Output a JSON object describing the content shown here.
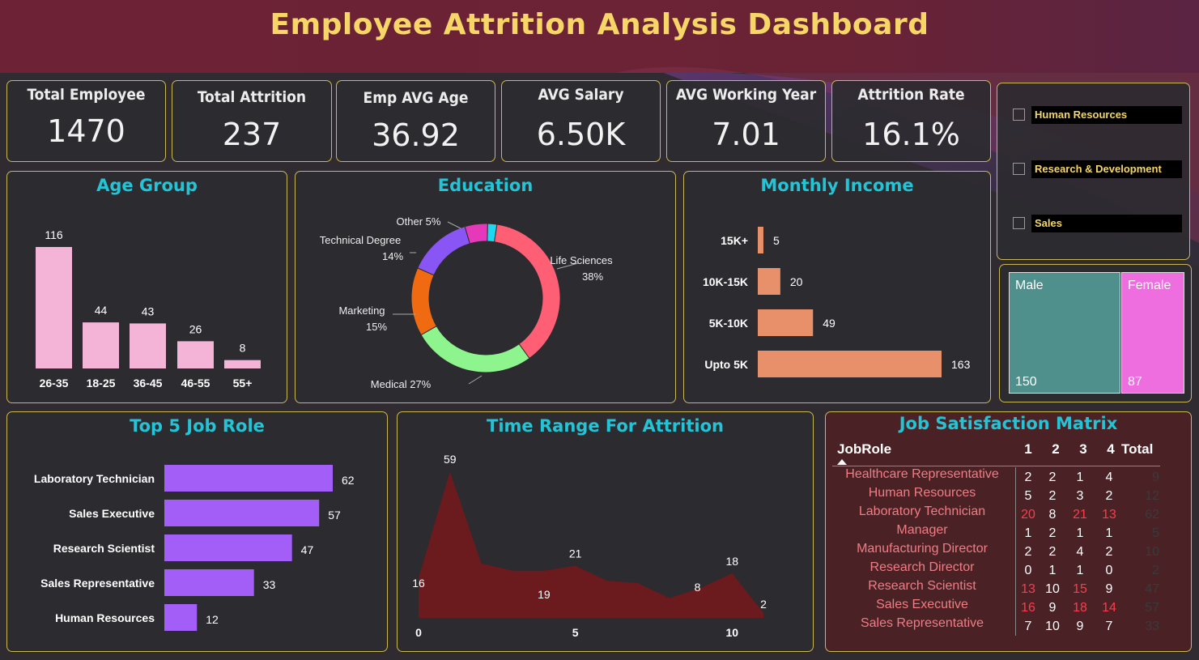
{
  "title": "Employee Attrition Analysis Dashboard",
  "colors": {
    "accent_title": "#f6d667",
    "panel_title": "#22c4d6",
    "age_bar": "#f3b4d8",
    "income_bar": "#e8906a",
    "jobrole_bar": "#a35ef7",
    "time_area": "#6b1a1e",
    "male": "#4f8f8c",
    "female": "#ee6ee0"
  },
  "kpis": [
    {
      "label": "Total Employee",
      "value": "1470"
    },
    {
      "label": "Total Attrition",
      "value": "237"
    },
    {
      "label": "Emp AVG Age",
      "value": "36.92"
    },
    {
      "label": "AVG Salary",
      "value": "6.50K"
    },
    {
      "label": "AVG Working Year",
      "value": "7.01"
    },
    {
      "label": "Attrition Rate",
      "value": "16.1%"
    }
  ],
  "slicer": {
    "items": [
      "Human Resources",
      "Research & Development",
      "Sales"
    ]
  },
  "gender": {
    "male_label": "Male",
    "male_value": "150",
    "female_label": "Female",
    "female_value": "87"
  },
  "panels": {
    "age_group": "Age Group",
    "education": "Education",
    "monthly_income": "Monthly Income",
    "top_job_role": "Top 5 Job Role",
    "time_range": "Time Range For Attrition",
    "job_satisfaction": "Job Satisfaction Matrix"
  },
  "chart_data": [
    {
      "type": "bar",
      "title": "Age Group",
      "categories": [
        "26-35",
        "18-25",
        "36-45",
        "46-55",
        "55+"
      ],
      "values": [
        116,
        44,
        43,
        26,
        8
      ],
      "ylim": [
        0,
        116
      ]
    },
    {
      "type": "pie",
      "title": "Education",
      "labels": [
        "Life Sciences",
        "Medical",
        "Marketing",
        "Technical Degree",
        "Other",
        ""
      ],
      "values": [
        38,
        27,
        15,
        14,
        5,
        2
      ],
      "label_text": [
        "Life Sciences",
        "Medical 27%",
        "Marketing",
        "Technical Degree",
        "Other 5%",
        ""
      ],
      "pct_text": [
        "38%",
        "",
        "15%",
        "14%",
        "",
        ""
      ],
      "colors": [
        "#ff5f74",
        "#8ef58e",
        "#f06a12",
        "#8a55f5",
        "#e639b9",
        "#1fd7ef"
      ]
    },
    {
      "type": "bar",
      "title": "Monthly Income",
      "orientation": "horizontal",
      "categories": [
        "15K+",
        "10K-15K",
        "5K-10K",
        "Upto 5K"
      ],
      "values": [
        5,
        20,
        49,
        163
      ]
    },
    {
      "type": "bar",
      "title": "Top 5 Job Role",
      "orientation": "horizontal",
      "categories": [
        "Laboratory Technician",
        "Sales Executive",
        "Research Scientist",
        "Sales Representative",
        "Human Resources"
      ],
      "values": [
        62,
        57,
        47,
        33,
        12
      ]
    },
    {
      "type": "area",
      "title": "Time Range For Attrition",
      "x": [
        0,
        1,
        2,
        3,
        4,
        5,
        6,
        7,
        8,
        9,
        10,
        11
      ],
      "y": [
        16,
        59,
        22,
        19,
        19,
        21,
        15,
        14,
        8,
        12,
        18,
        2
      ],
      "point_labels": [
        {
          "index": 0,
          "text": "16"
        },
        {
          "index": 1,
          "text": "59"
        },
        {
          "index": 4,
          "text": "19"
        },
        {
          "index": 5,
          "text": "21"
        },
        {
          "index": 9,
          "text": "8"
        },
        {
          "index": 10,
          "text": "18"
        },
        {
          "index": 11,
          "text": "2"
        }
      ],
      "xticks": [
        "0",
        "5",
        "10"
      ],
      "xlim": [
        0,
        11
      ],
      "ylim": [
        0,
        62
      ]
    },
    {
      "type": "table",
      "title": "Job Satisfaction Matrix",
      "columns": [
        "JobRole",
        "1",
        "2",
        "3",
        "4",
        "Total"
      ],
      "rows": [
        {
          "role": "Healthcare Representative",
          "v": [
            "2",
            "2",
            "1",
            "4"
          ],
          "total": "9"
        },
        {
          "role": "Human Resources",
          "v": [
            "5",
            "2",
            "3",
            "2"
          ],
          "total": "12"
        },
        {
          "role": "Laboratory Technician",
          "v": [
            "20",
            "8",
            "21",
            "13"
          ],
          "total": "62"
        },
        {
          "role": "Manager",
          "v": [
            "1",
            "2",
            "1",
            "1"
          ],
          "total": "5"
        },
        {
          "role": "Manufacturing Director",
          "v": [
            "2",
            "2",
            "4",
            "2"
          ],
          "total": "10"
        },
        {
          "role": "Research Director",
          "v": [
            "0",
            "1",
            "1",
            "0"
          ],
          "total": "2"
        },
        {
          "role": "Research Scientist",
          "v": [
            "13",
            "10",
            "15",
            "9"
          ],
          "total": "47"
        },
        {
          "role": "Sales Executive",
          "v": [
            "16",
            "9",
            "18",
            "14"
          ],
          "total": "57"
        },
        {
          "role": "Sales Representative",
          "v": [
            "7",
            "10",
            "9",
            "7"
          ],
          "total": "33"
        }
      ]
    }
  ]
}
